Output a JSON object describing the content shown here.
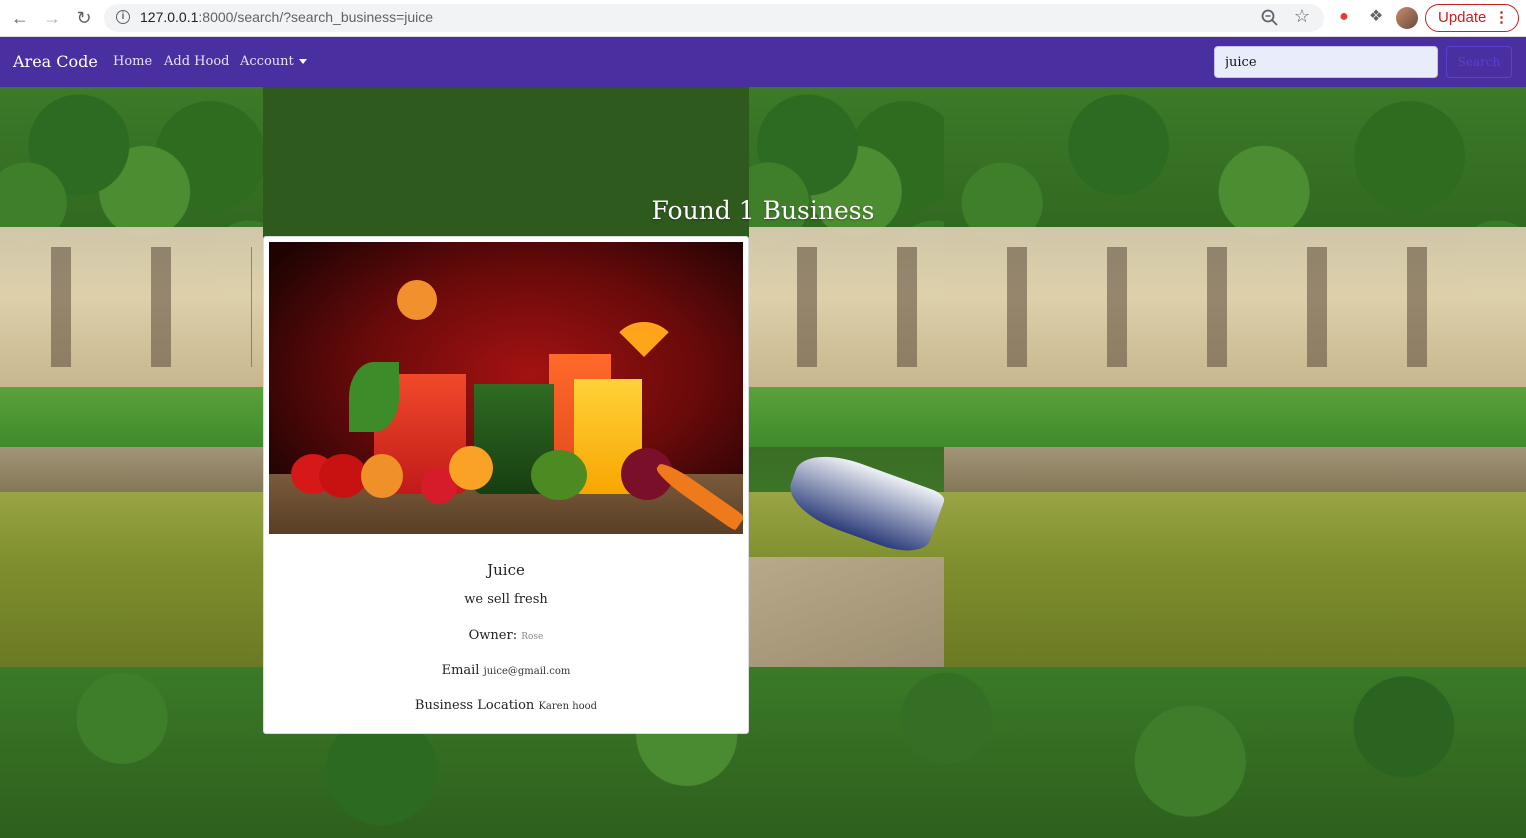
{
  "browser": {
    "url_host": "127.0.0.1",
    "url_rest": ":8000/search/?search_business=juice",
    "update_label": "Update"
  },
  "navbar": {
    "brand": "Area Code",
    "links": [
      "Home",
      "Add Hood",
      "Account"
    ],
    "search_value": "juice",
    "search_button": "Search"
  },
  "results": {
    "title": "Found 1 Business"
  },
  "business": {
    "name": "Juice",
    "description": "we sell fresh",
    "owner_label": "Owner:",
    "owner": "Rose",
    "email_label": "Email",
    "email": "juice@gmail.com",
    "location_label": "Business Location",
    "location": "Karen hood"
  },
  "colors": {
    "navbar": "#4a2fa0",
    "update_accent": "#c5221f",
    "search_button": "#5b3fd0"
  },
  "icons": [
    "back-arrow-icon",
    "forward-arrow-icon",
    "reload-icon",
    "info-icon",
    "zoom-icon",
    "star-icon",
    "extension-icon",
    "puzzle-icon",
    "profile-avatar",
    "kebab-menu-icon",
    "dropdown-caret-icon"
  ]
}
